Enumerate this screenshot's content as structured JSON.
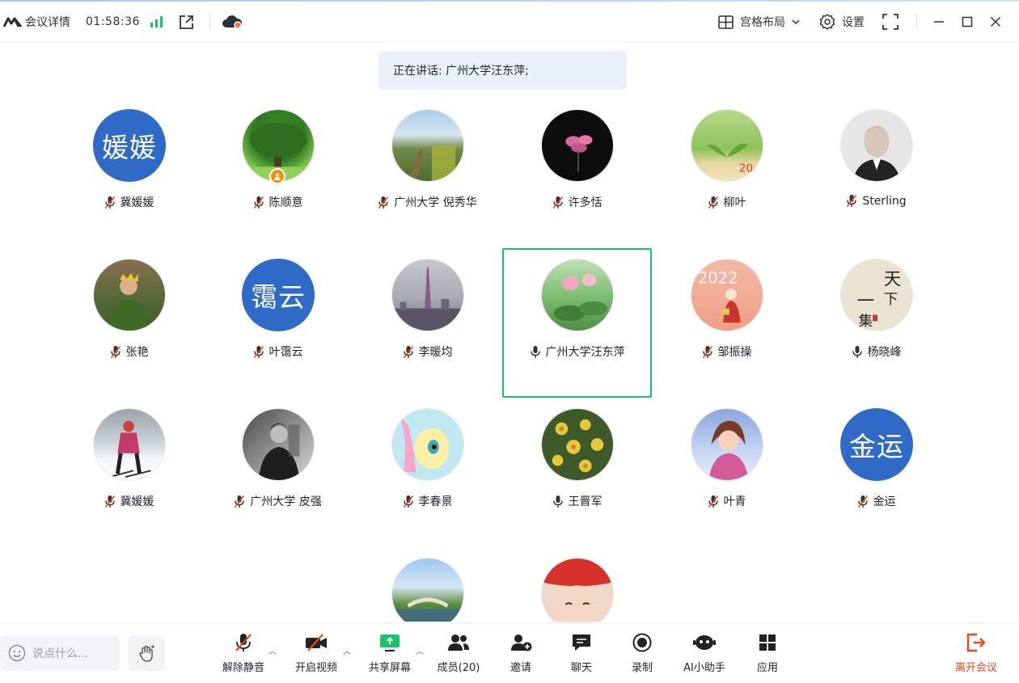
{
  "topbar": {
    "meeting_info": "会议详情",
    "timer": "01:58:36",
    "layout_label": "宫格布局",
    "settings_label": "设置"
  },
  "speaking_banner": "正在讲话: 广州大学汪东萍;",
  "participants": [
    {
      "name": "冀媛媛",
      "initials": "媛媛",
      "muted": true
    },
    {
      "name": "陈顺意",
      "muted": true
    },
    {
      "name": "广州大学 倪秀华",
      "muted": true
    },
    {
      "name": "许多恬",
      "muted": true
    },
    {
      "name": "柳叶",
      "muted": true
    },
    {
      "name": "Sterling",
      "muted": true
    },
    {
      "name": "张艳",
      "muted": true
    },
    {
      "name": "叶霭云",
      "initials": "霭云",
      "muted": true
    },
    {
      "name": "李暖均",
      "muted": true
    },
    {
      "name": "广州大学汪东萍",
      "muted": false
    },
    {
      "name": "邹振操",
      "muted": true
    },
    {
      "name": "杨晓峰",
      "muted": false
    },
    {
      "name": "冀媛媛",
      "muted": true
    },
    {
      "name": "广州大学 皮强",
      "muted": true
    },
    {
      "name": "李春景",
      "muted": true
    },
    {
      "name": "王晋军",
      "muted": false
    },
    {
      "name": "叶青",
      "muted": true
    },
    {
      "name": "金运",
      "initials": "金运",
      "muted": true
    }
  ],
  "toolbar": {
    "chat_placeholder": "说点什么...",
    "unmute": "解除静音",
    "start_video": "开启视频",
    "share_screen": "共享屏幕",
    "members": "成员(20)",
    "invite": "邀请",
    "chat": "聊天",
    "record": "录制",
    "ai_assistant": "AI小助手",
    "apps": "应用",
    "leave": "离开会议"
  },
  "colors": {
    "accent_green": "#19c26b",
    "initials_blue": "#2f6ac7",
    "leave_red": "#e8471b",
    "speaking_bg": "#ebf1fb"
  }
}
